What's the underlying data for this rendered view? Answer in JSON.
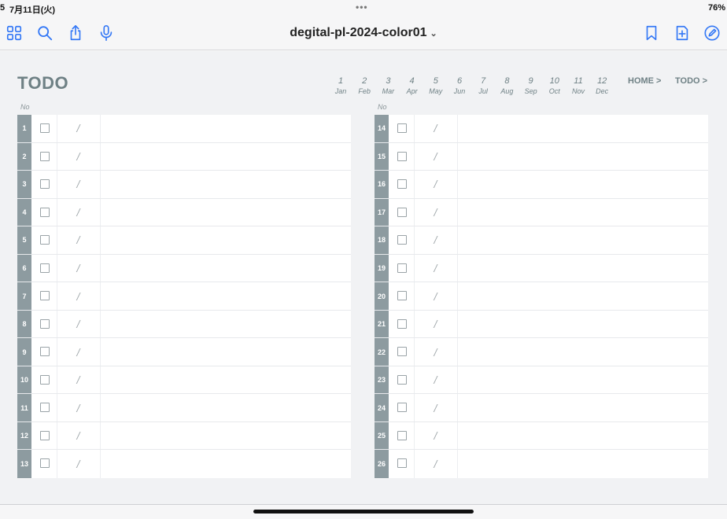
{
  "status": {
    "time_fragment": "5",
    "date": "7月11日(火)",
    "dots": "•••",
    "battery": "76%"
  },
  "toolbar": {
    "doc_title": "degital-pl-2024-color01",
    "title_chevron": "⌄"
  },
  "page": {
    "title": "TODO",
    "no_header": "No",
    "months": [
      {
        "num": "1",
        "name": "Jan"
      },
      {
        "num": "2",
        "name": "Feb"
      },
      {
        "num": "3",
        "name": "Mar"
      },
      {
        "num": "4",
        "name": "Apr"
      },
      {
        "num": "5",
        "name": "May"
      },
      {
        "num": "6",
        "name": "Jun"
      },
      {
        "num": "7",
        "name": "Jul"
      },
      {
        "num": "8",
        "name": "Aug"
      },
      {
        "num": "9",
        "name": "Sep"
      },
      {
        "num": "10",
        "name": "Oct"
      },
      {
        "num": "11",
        "name": "Nov"
      },
      {
        "num": "12",
        "name": "Dec"
      }
    ],
    "home_link": "HOME >",
    "todo_link": "TODO >",
    "date_placeholder": "/",
    "left_rows": [
      "1",
      "2",
      "3",
      "4",
      "5",
      "6",
      "7",
      "8",
      "9",
      "10",
      "11",
      "12",
      "13"
    ],
    "right_rows": [
      "14",
      "15",
      "16",
      "17",
      "18",
      "19",
      "20",
      "21",
      "22",
      "23",
      "24",
      "25",
      "26"
    ]
  },
  "colors": {
    "accent": "#3478f6",
    "number_column": "#8d9ba0",
    "heading": "#6f8185"
  },
  "icons": [
    "grid-icon",
    "search-icon",
    "share-icon",
    "microphone-icon",
    "bookmark-icon",
    "add-page-icon",
    "pencil-circle-icon"
  ]
}
